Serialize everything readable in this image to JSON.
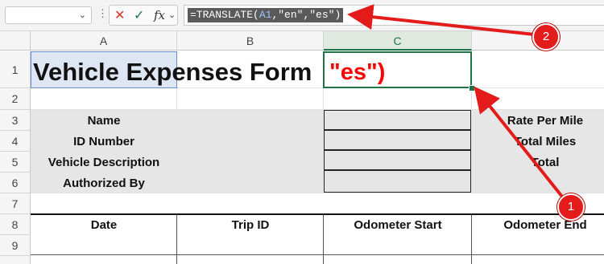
{
  "formula_bar": {
    "name_box_value": "",
    "cancel_icon": "cancel-x-icon",
    "enter_icon": "checkmark-icon",
    "fx_label": "fx",
    "formula_prefix": "=TRANSLATE(",
    "formula_ref": "A1",
    "formula_suffix": ",\"en\",\"es\")"
  },
  "columns": [
    "A",
    "B",
    "C"
  ],
  "rows": [
    "1",
    "2",
    "3",
    "4",
    "5",
    "6",
    "7",
    "8",
    "9"
  ],
  "cells": {
    "a1": "Vehicle Expenses Form",
    "c1": "\"es\")",
    "labels_left": [
      "Name",
      "ID Number",
      "Vehicle Description",
      "Authorized By"
    ],
    "labels_right": [
      "Rate Per Mile",
      "Total Miles",
      "Total"
    ],
    "table_headers": [
      "Date",
      "Trip ID",
      "Odometer Start",
      "Odometer End"
    ]
  },
  "annotations": {
    "marker_1": "1",
    "marker_2": "2",
    "color": "#e31b1b"
  }
}
